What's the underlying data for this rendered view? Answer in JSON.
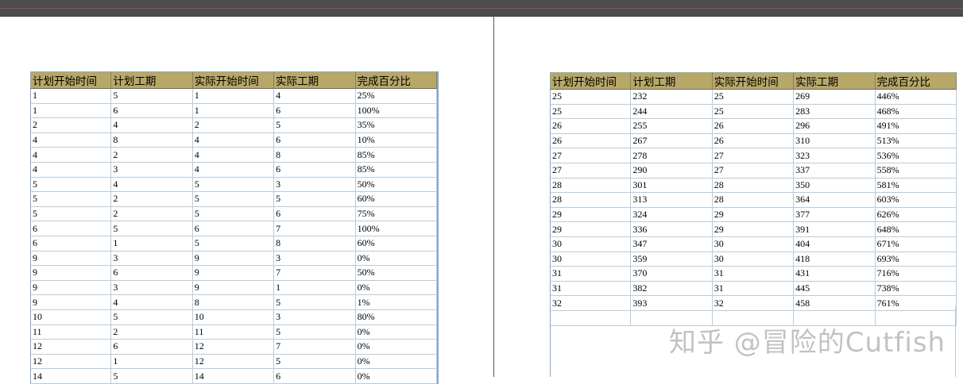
{
  "headers": [
    "计划开始时间",
    "计划工期",
    "实际开始时间",
    "实际工期",
    "完成百分比"
  ],
  "left_table": {
    "rows": [
      [
        "1",
        "5",
        "1",
        "4",
        "25%"
      ],
      [
        "1",
        "6",
        "1",
        "6",
        "100%"
      ],
      [
        "2",
        "4",
        "2",
        "5",
        "35%"
      ],
      [
        "4",
        "8",
        "4",
        "6",
        "10%"
      ],
      [
        "4",
        "2",
        "4",
        "8",
        "85%"
      ],
      [
        "4",
        "3",
        "4",
        "6",
        "85%"
      ],
      [
        "5",
        "4",
        "5",
        "3",
        "50%"
      ],
      [
        "5",
        "2",
        "5",
        "5",
        "60%"
      ],
      [
        "5",
        "2",
        "5",
        "6",
        "75%"
      ],
      [
        "6",
        "5",
        "6",
        "7",
        "100%"
      ],
      [
        "6",
        "1",
        "5",
        "8",
        "60%"
      ],
      [
        "9",
        "3",
        "9",
        "3",
        "0%"
      ],
      [
        "9",
        "6",
        "9",
        "7",
        "50%"
      ],
      [
        "9",
        "3",
        "9",
        "1",
        "0%"
      ],
      [
        "9",
        "4",
        "8",
        "5",
        "1%"
      ],
      [
        "10",
        "5",
        "10",
        "3",
        "80%"
      ],
      [
        "11",
        "2",
        "11",
        "5",
        "0%"
      ],
      [
        "12",
        "6",
        "12",
        "7",
        "0%"
      ],
      [
        "12",
        "1",
        "12",
        "5",
        "0%"
      ],
      [
        "14",
        "5",
        "14",
        "6",
        "0%"
      ]
    ]
  },
  "right_table": {
    "rows": [
      [
        "25",
        "232",
        "25",
        "269",
        "446%"
      ],
      [
        "25",
        "244",
        "25",
        "283",
        "468%"
      ],
      [
        "26",
        "255",
        "26",
        "296",
        "491%"
      ],
      [
        "26",
        "267",
        "26",
        "310",
        "513%"
      ],
      [
        "27",
        "278",
        "27",
        "323",
        "536%"
      ],
      [
        "27",
        "290",
        "27",
        "337",
        "558%"
      ],
      [
        "28",
        "301",
        "28",
        "350",
        "581%"
      ],
      [
        "28",
        "313",
        "28",
        "364",
        "603%"
      ],
      [
        "29",
        "324",
        "29",
        "377",
        "626%"
      ],
      [
        "29",
        "336",
        "29",
        "391",
        "648%"
      ],
      [
        "30",
        "347",
        "30",
        "404",
        "671%"
      ],
      [
        "30",
        "359",
        "30",
        "418",
        "693%"
      ],
      [
        "31",
        "370",
        "31",
        "431",
        "716%"
      ],
      [
        "31",
        "382",
        "31",
        "445",
        "738%"
      ],
      [
        "32",
        "393",
        "32",
        "458",
        "761%"
      ],
      [
        "",
        "",
        "",
        "",
        ""
      ]
    ]
  },
  "watermark": "知乎 @冒险的Cutfish",
  "colors": {
    "header_bg": "#b8a868",
    "grid_line": "#b9cbdc",
    "toolbar": "#4d4d4d"
  }
}
